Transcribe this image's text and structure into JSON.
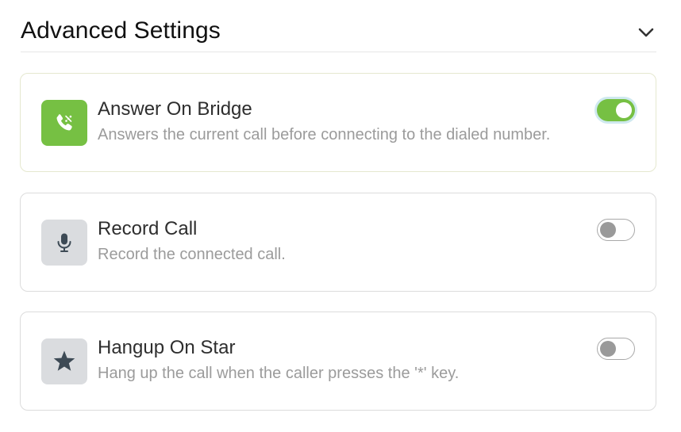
{
  "section": {
    "title": "Advanced Settings",
    "chevron_icon": "chevron-down-icon"
  },
  "settings": [
    {
      "title": "Answer On Bridge",
      "description": "Answers the current call before connecting to the dialed number.",
      "icon": "phone-bridge-icon",
      "icon_bg": "#76c043",
      "enabled": true
    },
    {
      "title": "Record Call",
      "description": "Record the connected call.",
      "icon": "microphone-icon",
      "icon_bg": "#dadcdf",
      "enabled": false
    },
    {
      "title": "Hangup On Star",
      "description": "Hang up the call when the caller presses the '*' key.",
      "icon": "star-icon",
      "icon_bg": "#dadcdf",
      "enabled": false
    }
  ],
  "colors": {
    "accent": "#76c043",
    "focus_ring": "#cfe9ef",
    "toggle_off_knob": "#9a9a9a"
  }
}
